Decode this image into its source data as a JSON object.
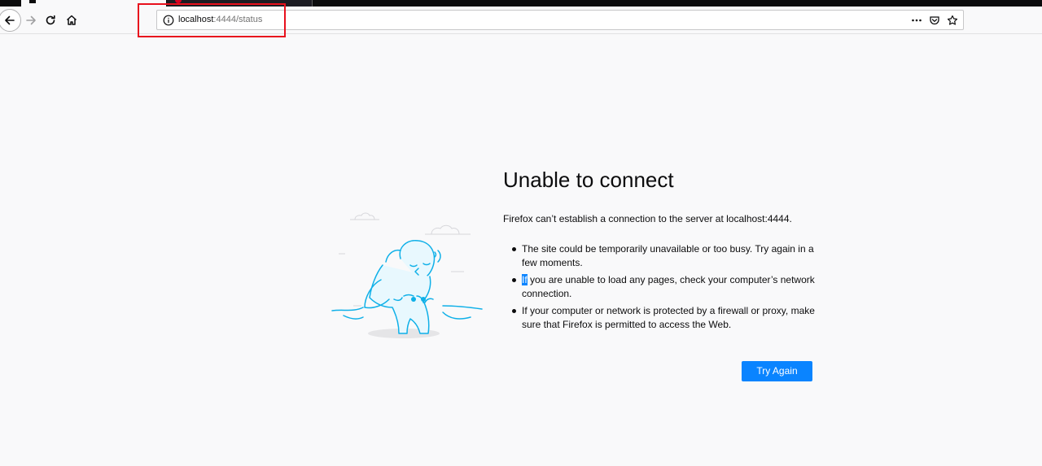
{
  "browser": {
    "url": {
      "host": "localhost",
      "rest": ":4444/status"
    }
  },
  "error": {
    "title": "Unable to connect",
    "intro": "Firefox can’t establish a connection to the server at localhost:4444.",
    "reasons": [
      {
        "text": "The site could be temporarily unavailable or too busy. Try again in a few moments."
      },
      {
        "selected": "If",
        "text": " you are unable to load any pages, check your computer’s network connection."
      },
      {
        "text": "If your computer or network is protected by a firewall or proxy, make sure that Firefox is permitted to access the Web."
      }
    ],
    "button_label": "Try Again"
  },
  "colors": {
    "accent": "#0a84ff",
    "highlight": "#e8101d"
  }
}
